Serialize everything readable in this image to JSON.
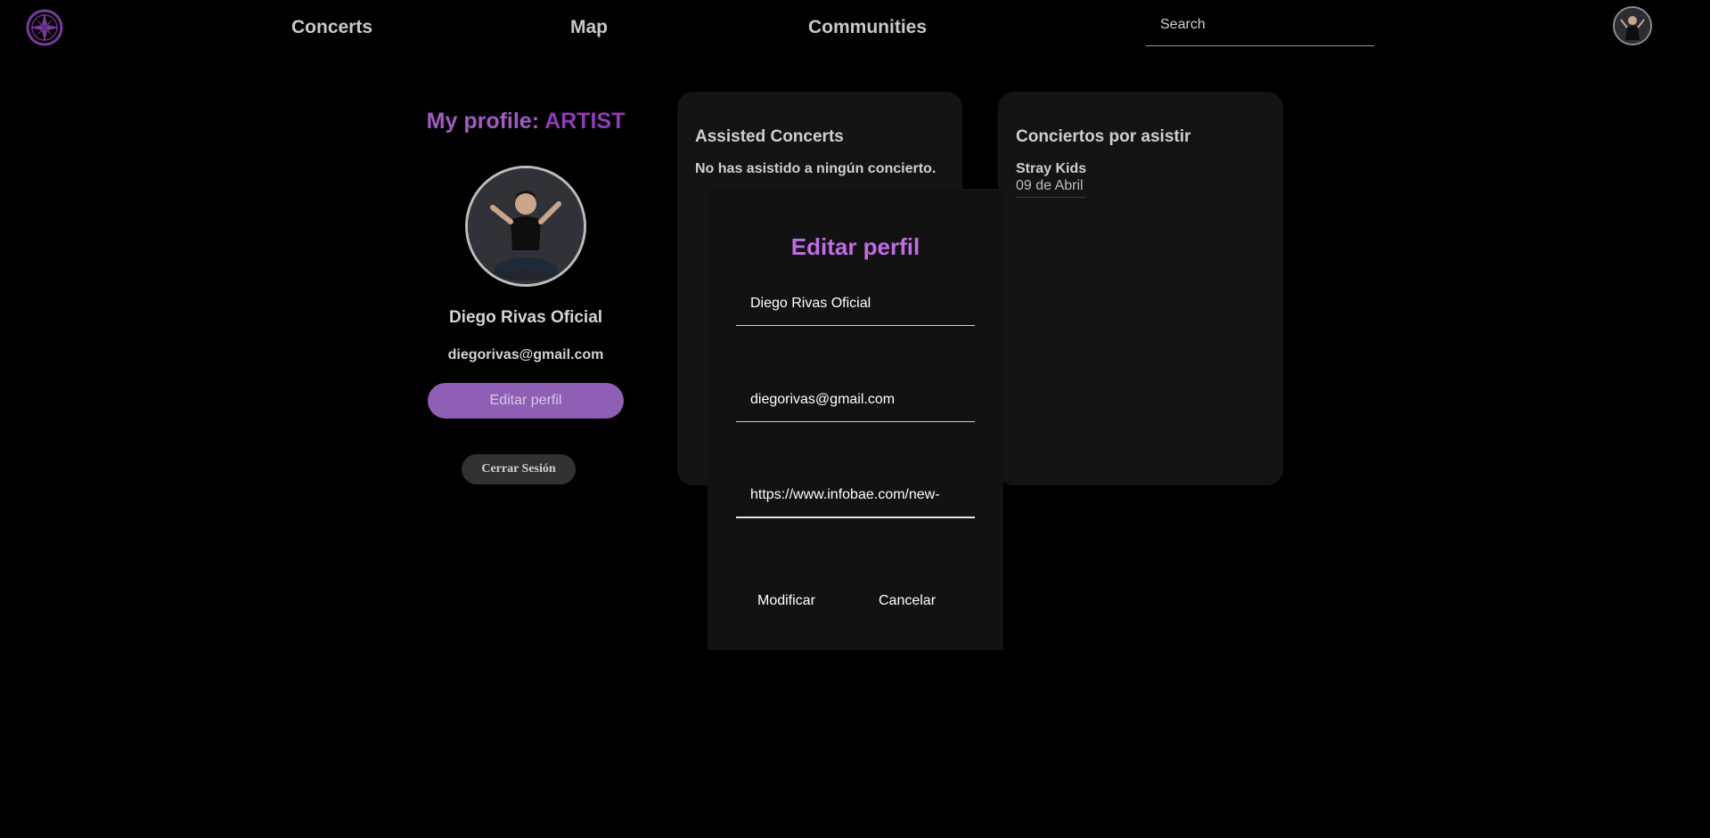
{
  "nav": {
    "links": [
      "Concerts",
      "Map",
      "Communities"
    ],
    "search_placeholder": "Search"
  },
  "profile": {
    "heading_prefix": "My profile: ",
    "role": "ARTIST",
    "name": "Diego Rivas Oficial",
    "email": "diegorivas@gmail.com",
    "edit_button": "Editar perfil",
    "logout_button": "Cerrar Sesión"
  },
  "assisted": {
    "title": "Assisted Concerts",
    "empty_message": "No has asistido a ningún concierto."
  },
  "upcoming": {
    "title": "Conciertos por asistir",
    "items": [
      {
        "artist": "Stray Kids",
        "date": "09 de Abril"
      }
    ]
  },
  "edit_modal": {
    "title": "Editar perfil",
    "name_value": "Diego Rivas Oficial",
    "email_value": "diegorivas@gmail.com",
    "image_url_value": "https://www.infobae.com/new-",
    "submit_label": "Modificar",
    "cancel_label": "Cancelar"
  },
  "colors": {
    "accent_purple": "#8e3db3",
    "modal_title": "#c06ce6",
    "edit_button_bg": "#8f5fb5",
    "card_bg": "#141414"
  },
  "icons": {
    "logo": "compass-star-icon",
    "user_avatar": "avatar"
  }
}
